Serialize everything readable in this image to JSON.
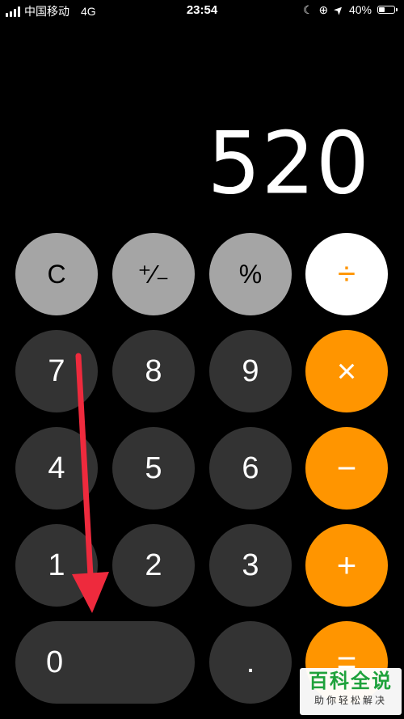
{
  "status_bar": {
    "carrier": "中国移动",
    "network": "4G",
    "time": "23:54",
    "moon_icon": "☾",
    "lock_rotation_icon": "⊕",
    "location_icon": "➤",
    "battery_percent": "40%",
    "battery_level": 0.4
  },
  "display": {
    "value": "520"
  },
  "keys": {
    "clear": "C",
    "plus_minus": "⁺∕₋",
    "percent": "%",
    "divide": "÷",
    "seven": "7",
    "eight": "8",
    "nine": "9",
    "multiply": "×",
    "four": "4",
    "five": "5",
    "six": "6",
    "minus": "−",
    "one": "1",
    "two": "2",
    "three": "3",
    "plus": "+",
    "zero": "0",
    "decimal": ".",
    "equals": "="
  },
  "watermark": {
    "title": "百科全说",
    "subtitle": "助你轻松解决"
  },
  "colors": {
    "operator": "#ff9500",
    "function_key": "#a5a5a5",
    "digit_key": "#333333",
    "annotation_arrow": "#ee2a3d",
    "watermark_green": "#1fa23b"
  }
}
